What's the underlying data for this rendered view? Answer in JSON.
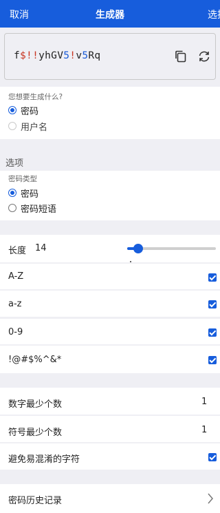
{
  "navbar": {
    "cancel_label": "取消",
    "title": "生成器",
    "select_label": "选择"
  },
  "password": {
    "segments": [
      {
        "text": "f",
        "kind": "letter"
      },
      {
        "text": "$!!",
        "kind": "symbol"
      },
      {
        "text": "yhGV",
        "kind": "letter"
      },
      {
        "text": "5",
        "kind": "number"
      },
      {
        "text": "!",
        "kind": "symbol"
      },
      {
        "text": "v",
        "kind": "letter"
      },
      {
        "text": "5",
        "kind": "number"
      },
      {
        "text": "Rq",
        "kind": "letter"
      }
    ],
    "copy_icon": "copy-icon",
    "regenerate_icon": "refresh-icon"
  },
  "generate_type": {
    "label": "您想要生成什么?",
    "options": [
      {
        "label": "密码",
        "selected": true
      },
      {
        "label": "用户名",
        "selected": false
      }
    ]
  },
  "options_header": "选项",
  "password_type": {
    "label": "密码类型",
    "options": [
      {
        "label": "密码",
        "selected": true
      },
      {
        "label": "密码短语",
        "selected": false
      }
    ]
  },
  "length": {
    "label": "长度",
    "value": "14",
    "min": 5,
    "max": 128,
    "current": 14
  },
  "char_sets": [
    {
      "label": "A-Z",
      "checked": true
    },
    {
      "label": "a-z",
      "checked": true
    },
    {
      "label": "0-9",
      "checked": true
    },
    {
      "label": "!@#$%^&*",
      "checked": true
    }
  ],
  "min_numbers": {
    "label": "数字最少个数",
    "value": "1"
  },
  "min_special": {
    "label": "符号最少个数",
    "value": "1"
  },
  "avoid_ambiguous": {
    "label": "避免易混淆的字符",
    "checked": true
  },
  "history": {
    "label": "密码历史记录",
    "icon": "chevron-right-icon"
  },
  "colors": {
    "accent": "#175ddc",
    "symbol": "#c83522",
    "number": "#1a5bd6",
    "background": "#efeff4"
  }
}
